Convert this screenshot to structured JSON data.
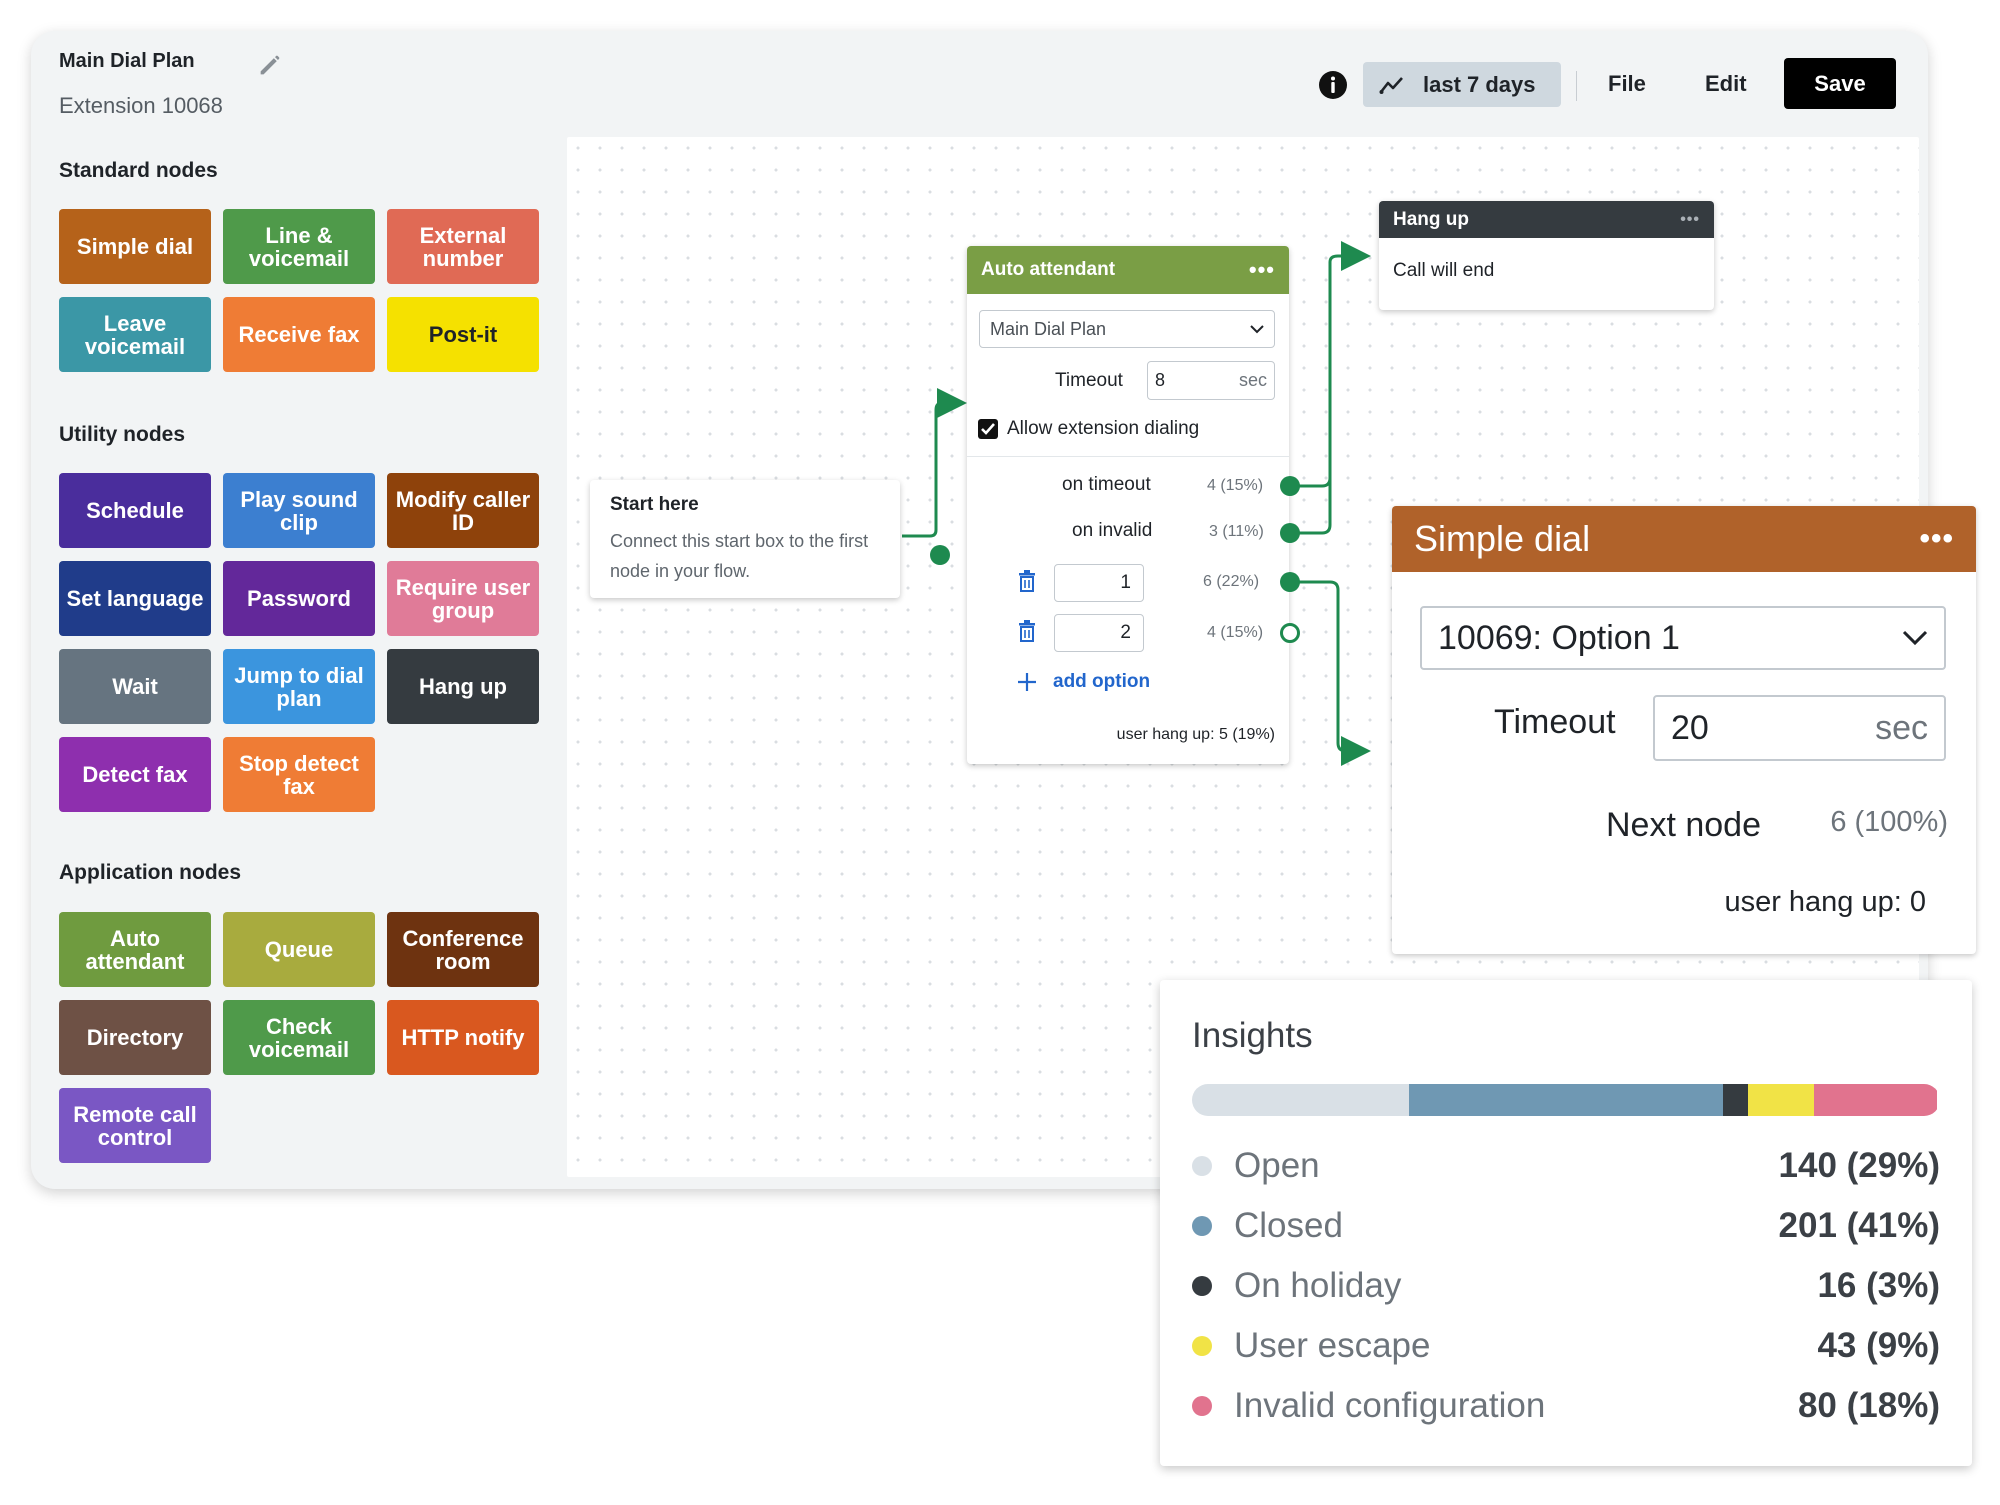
{
  "header": {
    "title": "Main Dial Plan",
    "extension": "Extension 10068"
  },
  "toolbar": {
    "range_label": "last 7 days",
    "file_label": "File",
    "edit_label": "Edit",
    "save_label": "Save"
  },
  "sidebar": {
    "standard_heading": "Standard nodes",
    "utility_heading": "Utility nodes",
    "application_heading": "Application nodes",
    "standard": [
      {
        "label": "Simple dial",
        "color": "#b5621a"
      },
      {
        "label": "Line & voicemail",
        "color": "#4f9a4a"
      },
      {
        "label": "External number",
        "color": "#e06a55"
      },
      {
        "label": "Leave voicemail",
        "color": "#3b97a6"
      },
      {
        "label": "Receive fax",
        "color": "#ef7c35"
      },
      {
        "label": "Post-it",
        "color": "#f5e100"
      }
    ],
    "utility": [
      {
        "label": "Schedule",
        "color": "#4a2d9c"
      },
      {
        "label": "Play sound clip",
        "color": "#3c7fd0"
      },
      {
        "label": "Modify caller ID",
        "color": "#8e420b"
      },
      {
        "label": "Set language",
        "color": "#203c8a"
      },
      {
        "label": "Password",
        "color": "#63289a"
      },
      {
        "label": "Require user group",
        "color": "#e07b98"
      },
      {
        "label": "Wait",
        "color": "#667480"
      },
      {
        "label": "Jump to dial plan",
        "color": "#3b95de"
      },
      {
        "label": "Hang up",
        "color": "#353b40"
      },
      {
        "label": "Detect fax",
        "color": "#8e2fae"
      },
      {
        "label": "Stop detect fax",
        "color": "#ef7c35"
      }
    ],
    "application": [
      {
        "label": "Auto attendant",
        "color": "#6f9b3f"
      },
      {
        "label": "Queue",
        "color": "#a8ab3e"
      },
      {
        "label": "Conference room",
        "color": "#6e3310"
      },
      {
        "label": "Directory",
        "color": "#6e5145"
      },
      {
        "label": "Check voicemail",
        "color": "#4f9a4a"
      },
      {
        "label": "HTTP notify",
        "color": "#d9581f"
      },
      {
        "label": "Remote call control",
        "color": "#7a57c4"
      }
    ]
  },
  "start_node": {
    "title": "Start here",
    "description": "Connect this start box to the first node in your flow."
  },
  "auto_attendant": {
    "title": "Auto attendant",
    "color": "#7a9e45",
    "plan_select": "Main Dial Plan",
    "timeout_label": "Timeout",
    "timeout_value": "8",
    "timeout_unit": "sec",
    "allow_ext_label": "Allow extension dialing",
    "on_timeout_label": "on timeout",
    "on_timeout_count": "4 (15%)",
    "on_invalid_label": "on invalid",
    "on_invalid_count": "3 (11%)",
    "option1_value": "1",
    "option1_count": "6 (22%)",
    "option2_value": "2",
    "option2_count": "4 (15%)",
    "add_option_label": "add option",
    "user_hangup": "user hang up: 5 (19%)"
  },
  "hang_up_node": {
    "title": "Hang up",
    "color": "#353b40",
    "body": "Call will end"
  },
  "simple_dial": {
    "title": "Simple dial",
    "color": "#b0622a",
    "select_value": "10069: Option 1",
    "timeout_label": "Timeout",
    "timeout_value": "20",
    "timeout_unit": "sec",
    "next_node_label": "Next node",
    "next_node_count": "6 (100%)",
    "user_hangup": "user hang up: 0"
  },
  "insights": {
    "title": "Insights",
    "items": [
      {
        "label": "Open",
        "value": "140 (29%)",
        "share": 0.29,
        "color": "#d9e0e6"
      },
      {
        "label": "Closed",
        "value": "201 (41%)",
        "share": 0.42,
        "color": "#6f98b3"
      },
      {
        "label": "On holiday",
        "value": "16 (3%)",
        "share": 0.033,
        "color": "#353b40"
      },
      {
        "label": "User escape",
        "value": "43 (9%)",
        "share": 0.088,
        "color": "#f1e346"
      },
      {
        "label": "Invalid configuration",
        "value": "80 (18%)",
        "share": 0.165,
        "color": "#e1738e"
      }
    ]
  },
  "colors": {
    "connector": "#1e8a4f",
    "link": "#2266cc"
  }
}
